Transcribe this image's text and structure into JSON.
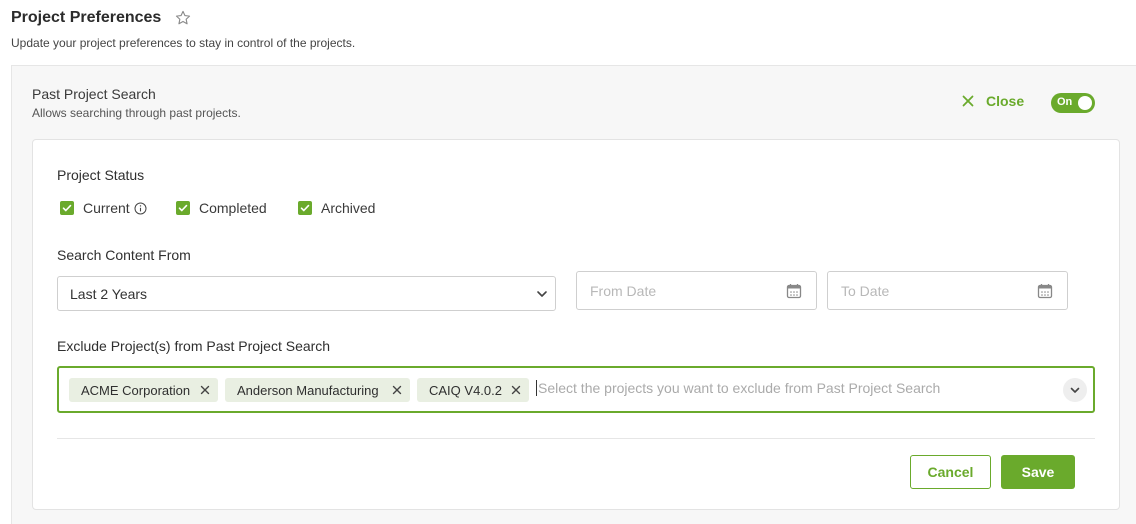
{
  "page": {
    "title": "Project Preferences",
    "subtitle": "Update your project preferences to stay in control of the projects."
  },
  "section": {
    "title": "Past Project Search",
    "description": "Allows searching through past projects.",
    "close_label": "Close",
    "toggle_label": "On",
    "toggle_state": "on"
  },
  "status": {
    "label": "Project Status",
    "options": [
      {
        "label": "Current",
        "checked": true,
        "info": true
      },
      {
        "label": "Completed",
        "checked": true
      },
      {
        "label": "Archived",
        "checked": true
      }
    ]
  },
  "search_content": {
    "label": "Search Content From",
    "selected": "Last 2 Years",
    "from_placeholder": "From Date",
    "to_placeholder": "To Date"
  },
  "exclude": {
    "label": "Exclude Project(s) from Past Project Search",
    "chips": [
      "ACME Corporation",
      "Anderson Manufacturing",
      "CAIQ V4.0.2"
    ],
    "placeholder": "Select the projects you want to exclude from Past Project Search"
  },
  "actions": {
    "cancel": "Cancel",
    "save": "Save"
  },
  "colors": {
    "accent": "#6aaa2c",
    "chip_bg": "#e9efe2"
  }
}
